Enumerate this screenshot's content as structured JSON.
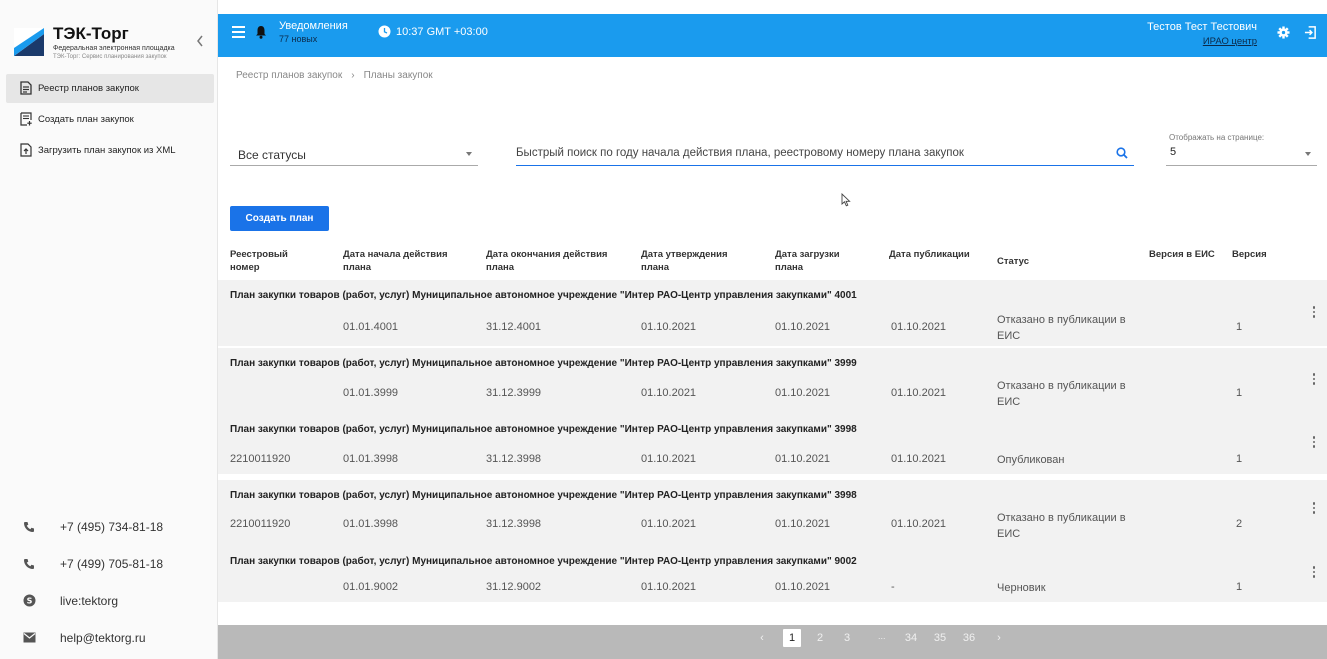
{
  "brand": {
    "title": "ТЭК-Торг",
    "subtitle": "Федеральная электронная площадка",
    "subsubtitle": "ТЭК-Торг: Сервис планирования закупок"
  },
  "sidebar": {
    "items": [
      {
        "label": "Реестр планов закупок",
        "icon": "document-list-icon"
      },
      {
        "label": "Создать план закупок",
        "icon": "document-add-icon"
      },
      {
        "label": "Загрузить план закупок из XML",
        "icon": "document-upload-icon"
      }
    ],
    "contacts": [
      {
        "text": "+7 (495) 734-81-18",
        "icon": "phone-icon"
      },
      {
        "text": "+7 (499) 705-81-18",
        "icon": "phone-icon"
      },
      {
        "text": "live:tektorg",
        "icon": "skype-icon"
      },
      {
        "text": "help@tektorg.ru",
        "icon": "mail-icon"
      }
    ]
  },
  "topbar": {
    "notifications_label": "Уведомления",
    "notifications_count": "77 новых",
    "time": "10:37 GMT +03:00",
    "user_name": "Тестов Тест Тестович",
    "user_org": "ИРАО центр",
    "accent": "#1a9bee"
  },
  "breadcrumb": [
    "Реестр планов закупок",
    "Планы закупок"
  ],
  "filters": {
    "status_value": "Все статусы",
    "search_placeholder": "Быстрый поиск по году начала действия плана, реестровому номеру плана закупок",
    "perpage_label": "Отображать на странице:",
    "perpage_value": "5"
  },
  "create_button": "Создать план",
  "table": {
    "headers": [
      "Реестровый номер",
      "Дата начала действия плана",
      "Дата окончания действия плана",
      "Дата утверждения плана",
      "Дата загрузки плана",
      "Дата публикации",
      "Статус",
      "Версия в ЕИС",
      "Версия"
    ],
    "groups": [
      {
        "title": "План закупки товаров (работ, услуг) Муниципальное автономное учреждение \"Интер РАО-Центр управления закупками\" 4001",
        "reg": "",
        "start": "01.01.4001",
        "end": "31.12.4001",
        "approved": "01.10.2021",
        "loaded": "01.10.2021",
        "published": "01.10.2021",
        "status": "Отказано в публикации в ЕИС",
        "eis_version": "",
        "version": "1"
      },
      {
        "title": "План закупки товаров (работ, услуг) Муниципальное автономное учреждение \"Интер РАО-Центр управления закупками\" 3999",
        "reg": "",
        "start": "01.01.3999",
        "end": "31.12.3999",
        "approved": "01.10.2021",
        "loaded": "01.10.2021",
        "published": "01.10.2021",
        "status": "Отказано в публикации в ЕИС",
        "eis_version": "",
        "version": "1"
      },
      {
        "title": "План закупки товаров (работ, услуг) Муниципальное автономное учреждение \"Интер РАО-Центр управления закупками\" 3998",
        "reg": "2210011920",
        "start": "01.01.3998",
        "end": "31.12.3998",
        "approved": "01.10.2021",
        "loaded": "01.10.2021",
        "published": "01.10.2021",
        "status": "Опубликован",
        "eis_version": "",
        "version": "1"
      },
      {
        "title": "План закупки товаров (работ, услуг) Муниципальное автономное учреждение \"Интер РАО-Центр управления закупками\" 3998",
        "reg": "2210011920",
        "start": "01.01.3998",
        "end": "31.12.3998",
        "approved": "01.10.2021",
        "loaded": "01.10.2021",
        "published": "01.10.2021",
        "status": "Отказано в публикации в ЕИС",
        "eis_version": "",
        "version": "2"
      },
      {
        "title": "План закупки товаров (работ, услуг) Муниципальное автономное учреждение \"Интер РАО-Центр управления закупками\" 9002",
        "reg": "",
        "start": "01.01.9002",
        "end": "31.12.9002",
        "approved": "01.10.2021",
        "loaded": "01.10.2021",
        "published": "-",
        "status": "Черновик",
        "eis_version": "",
        "version": "1"
      }
    ]
  },
  "pagination": {
    "prev": "‹",
    "pages": [
      "1",
      "2",
      "3"
    ],
    "ellipsis": "...",
    "pages_end": [
      "34",
      "35",
      "36"
    ],
    "next": "›",
    "active": "1"
  }
}
